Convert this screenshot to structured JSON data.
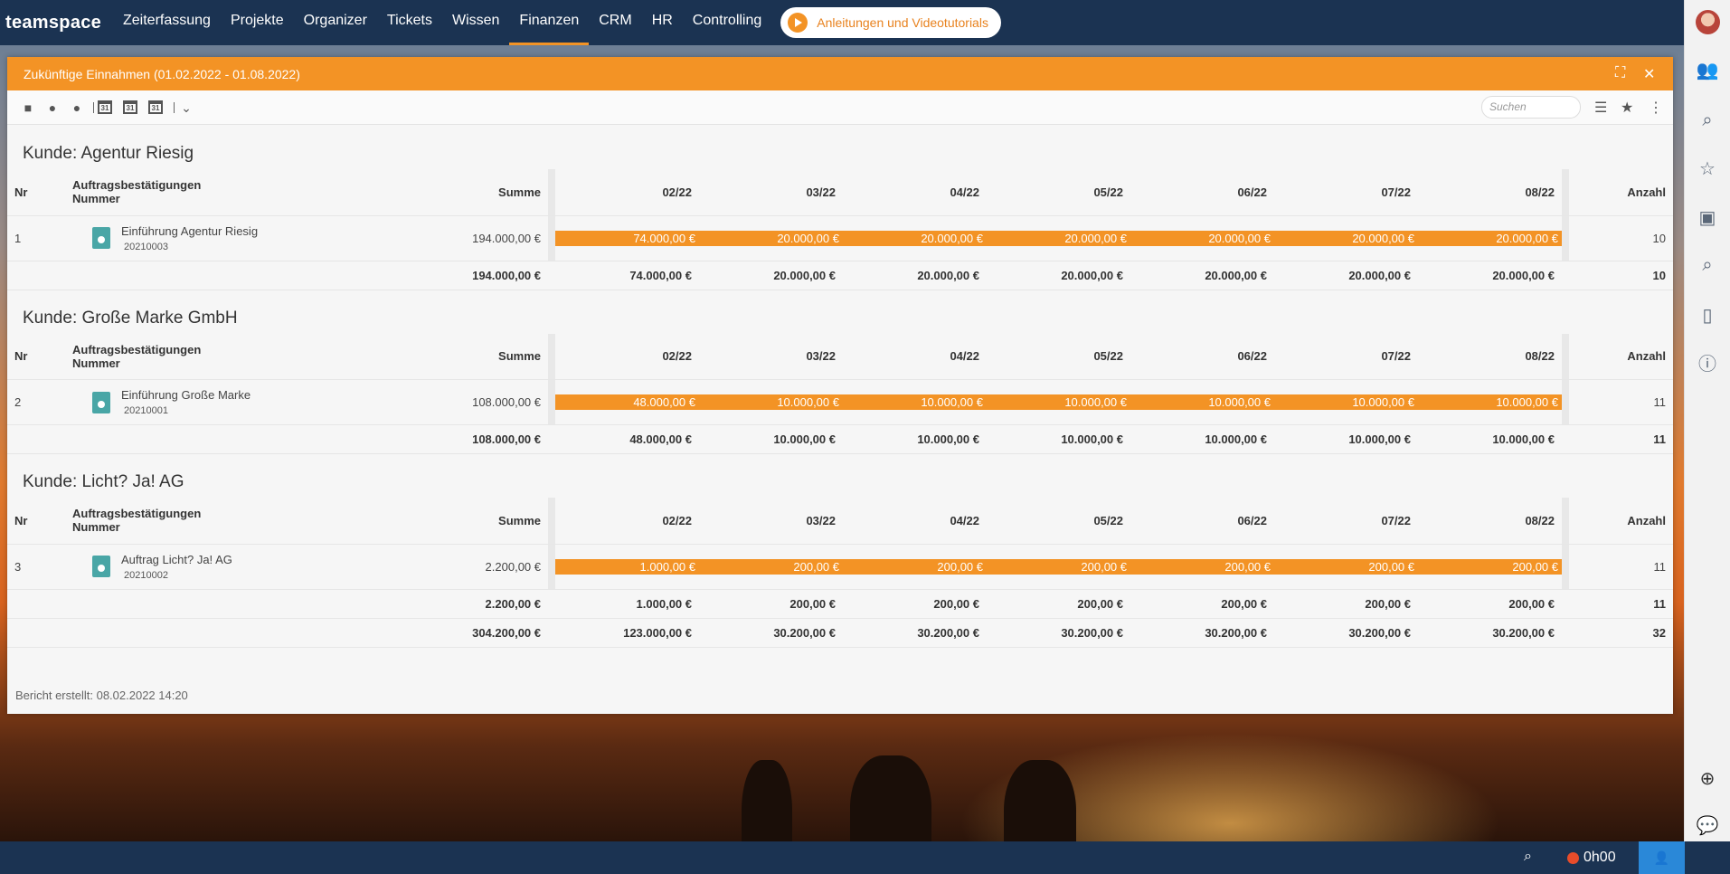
{
  "nav": {
    "logo": "teamspace",
    "items": [
      "Zeiterfassung",
      "Projekte",
      "Organizer",
      "Tickets",
      "Wissen",
      "Finanzen",
      "CRM",
      "HR",
      "Controlling"
    ],
    "active": "Finanzen",
    "tutorial_label": "Anleitungen und Videotutorials"
  },
  "panel": {
    "title": "Zukünftige Einnahmen (01.02.2022 - 01.08.2022)",
    "search_placeholder": "Suchen",
    "toolbar_cal_label": "31"
  },
  "table_headers": {
    "nr": "Nr",
    "name_line1": "Auftragsbestätigungen",
    "name_line2": "Nummer",
    "summe": "Summe",
    "months": [
      "02/22",
      "03/22",
      "04/22",
      "05/22",
      "06/22",
      "07/22",
      "08/22"
    ],
    "anzahl": "Anzahl"
  },
  "groups": [
    {
      "title": "Kunde: Agentur Riesig",
      "row": {
        "nr": "1",
        "name": "Einführung Agentur Riesig",
        "number": "20210003",
        "summe": "194.000,00 €",
        "months": [
          "74.000,00 €",
          "20.000,00 €",
          "20.000,00 €",
          "20.000,00 €",
          "20.000,00 €",
          "20.000,00 €",
          "20.000,00 €"
        ],
        "anzahl": "10"
      },
      "total": {
        "summe": "194.000,00 €",
        "months": [
          "74.000,00 €",
          "20.000,00 €",
          "20.000,00 €",
          "20.000,00 €",
          "20.000,00 €",
          "20.000,00 €",
          "20.000,00 €"
        ],
        "anzahl": "10"
      }
    },
    {
      "title": "Kunde: Große Marke GmbH",
      "row": {
        "nr": "2",
        "name": "Einführung Große Marke",
        "number": "20210001",
        "summe": "108.000,00 €",
        "months": [
          "48.000,00 €",
          "10.000,00 €",
          "10.000,00 €",
          "10.000,00 €",
          "10.000,00 €",
          "10.000,00 €",
          "10.000,00 €"
        ],
        "anzahl": "11"
      },
      "total": {
        "summe": "108.000,00 €",
        "months": [
          "48.000,00 €",
          "10.000,00 €",
          "10.000,00 €",
          "10.000,00 €",
          "10.000,00 €",
          "10.000,00 €",
          "10.000,00 €"
        ],
        "anzahl": "11"
      }
    },
    {
      "title": "Kunde: Licht? Ja! AG",
      "row": {
        "nr": "3",
        "name": "Auftrag Licht? Ja! AG",
        "number": "20210002",
        "summe": "2.200,00 €",
        "months": [
          "1.000,00 €",
          "200,00 €",
          "200,00 €",
          "200,00 €",
          "200,00 €",
          "200,00 €",
          "200,00 €"
        ],
        "anzahl": "11"
      },
      "total": {
        "summe": "2.200,00 €",
        "months": [
          "1.000,00 €",
          "200,00 €",
          "200,00 €",
          "200,00 €",
          "200,00 €",
          "200,00 €",
          "200,00 €"
        ],
        "anzahl": "11"
      }
    }
  ],
  "grand_total": {
    "summe": "304.200,00 €",
    "months": [
      "123.000,00 €",
      "30.200,00 €",
      "30.200,00 €",
      "30.200,00 €",
      "30.200,00 €",
      "30.200,00 €",
      "30.200,00 €"
    ],
    "anzahl": "32"
  },
  "footer": "Bericht erstellt: 08.02.2022 14:20",
  "bottombar": {
    "timer": "0h00"
  },
  "colors": {
    "accent": "#f39325",
    "navbar": "#1b3352",
    "doc_icon": "#49a6a6"
  }
}
